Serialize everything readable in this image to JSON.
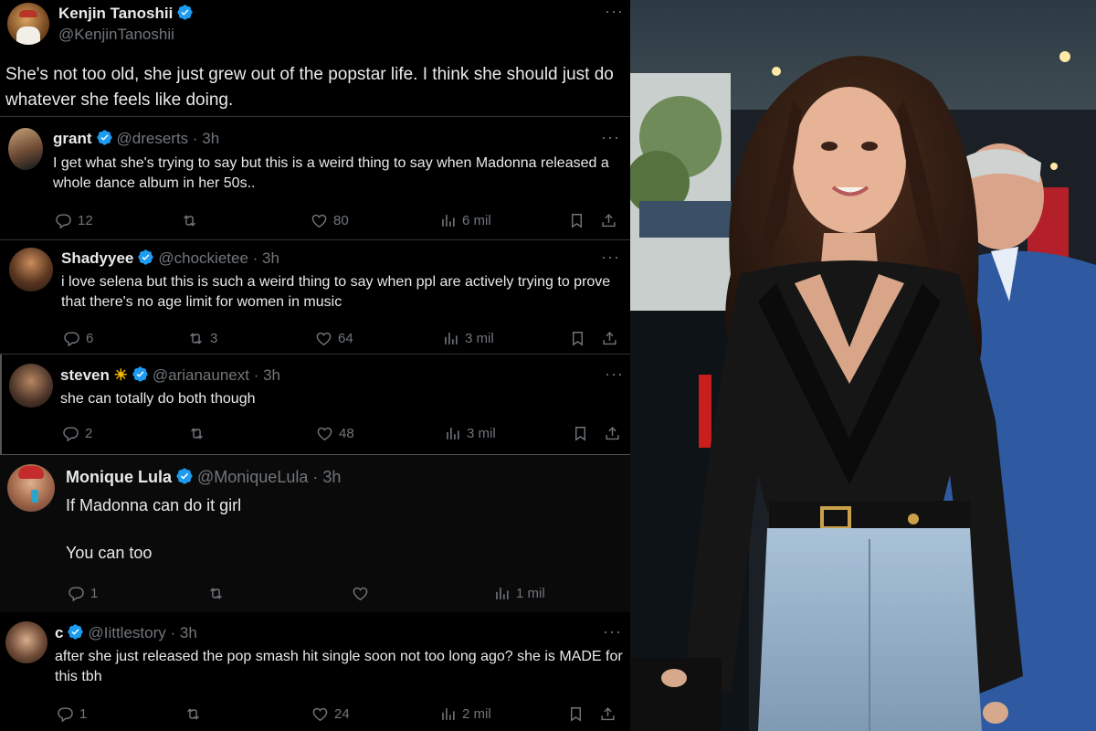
{
  "main_tweet": {
    "name": "Kenjin Tanoshii",
    "handle": "@KenjinTanoshii",
    "text": "She's not too old, she just grew out of the popstar life. I think she should just do whatever she feels like doing."
  },
  "replies": [
    {
      "name": "grant",
      "handle": "@dreserts",
      "time": "· 3h",
      "text": "I get what she's trying to say but this is a weird thing to say when Madonna released a whole dance album in her 50s..",
      "replies": "12",
      "reposts": "",
      "likes": "80",
      "views": "6 mil"
    },
    {
      "name": "Shadyyee",
      "handle": "@chockietee",
      "time": "· 3h",
      "text": "i love selena but this is such a weird thing to say when ppl are actively trying to prove that there's no age limit for women in music",
      "replies": "6",
      "reposts": "3",
      "likes": "64",
      "views": "3 mil"
    },
    {
      "name": "steven",
      "emoji": "☀",
      "handle": "@arianaunext",
      "time": "· 3h",
      "text": "she can totally do both though",
      "replies": "2",
      "reposts": "",
      "likes": "48",
      "views": "3 mil"
    },
    {
      "name": "Monique Lula",
      "handle": "@MoniqueLula",
      "time": "· 3h",
      "text": "If Madonna can do it girl\n\nYou can too",
      "replies": "1",
      "reposts": "",
      "likes": "",
      "views": "1 mil"
    },
    {
      "name": "c",
      "handle": "@Iittlestory",
      "time": "· 3h",
      "text": "after she just released the pop smash hit single soon not too long ago? she is MADE for this tbh",
      "replies": "1",
      "reposts": "",
      "likes": "24",
      "views": "2 mil"
    }
  ],
  "icons": {
    "verified": "verified-badge-icon",
    "more": "more-options-icon",
    "reply": "reply-icon",
    "repost": "repost-icon",
    "like": "heart-icon",
    "views": "views-icon",
    "bookmark": "bookmark-icon",
    "share": "share-icon"
  },
  "colors": {
    "background": "#000000",
    "text": "#e7e9ea",
    "muted": "#71767b",
    "verified": "#1d9bf0",
    "divider": "#2f3336"
  }
}
